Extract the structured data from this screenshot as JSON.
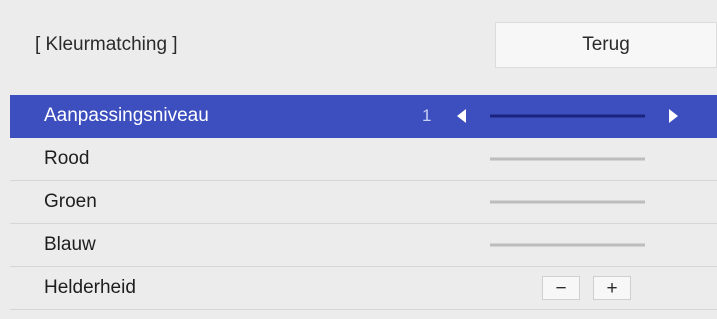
{
  "header": {
    "title": "[ Kleurmatching ]",
    "back_label": "Terug"
  },
  "menu": {
    "items": [
      {
        "label": "Aanpassingsniveau",
        "value": "1",
        "selected": true
      },
      {
        "label": "Rood"
      },
      {
        "label": "Groen"
      },
      {
        "label": "Blauw"
      },
      {
        "label": "Helderheid",
        "minus_label": "−",
        "plus_label": "+"
      }
    ]
  },
  "colors": {
    "selection": "#3d4fbf",
    "background": "#ececec"
  },
  "icons": [
    "triangle-left-icon",
    "triangle-right-icon"
  ]
}
